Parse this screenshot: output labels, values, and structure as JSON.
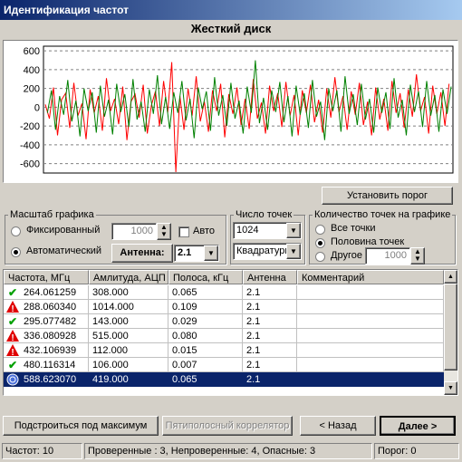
{
  "window": {
    "title": "Идентификация частот"
  },
  "chart_data": {
    "type": "line",
    "title": "Жесткий диск",
    "ylim": [
      -700,
      650
    ],
    "y_ticks": [
      "600",
      "400",
      "200",
      "0",
      "-200",
      "-400",
      "-600"
    ],
    "y_tick_values": [
      600,
      400,
      200,
      0,
      -200,
      -400,
      -600
    ],
    "grid": true,
    "series": [
      {
        "color": "#ff0000",
        "values": [
          30,
          -120,
          210,
          -300,
          80,
          150,
          -220,
          260,
          -90,
          40,
          -340,
          190,
          -60,
          120,
          -250,
          310,
          -40,
          90,
          -180,
          220,
          -350,
          60,
          140,
          -110,
          240,
          -280,
          20,
          170,
          -200,
          280,
          -60,
          480,
          -690,
          120,
          -240,
          200,
          -90,
          330,
          -150,
          60,
          -260,
          180,
          -40,
          250,
          -320,
          140,
          -70,
          210,
          -190,
          90,
          -230,
          300,
          -120,
          50,
          -280,
          230,
          -40,
          150,
          -210,
          270,
          -90,
          130,
          -300,
          180,
          -60,
          240,
          -160,
          80,
          -270,
          200,
          -110,
          320,
          -50,
          120,
          -240,
          170,
          -80,
          260,
          -190,
          60,
          -300,
          210,
          -130,
          90,
          -250,
          280,
          -60,
          150,
          -220,
          190,
          -100,
          350,
          -40,
          110,
          -280,
          230,
          -70,
          160,
          -200,
          250
        ]
      },
      {
        "color": "#008000",
        "values": [
          -60,
          180,
          -240,
          120,
          -80,
          290,
          -150,
          70,
          -310,
          200,
          -40,
          160,
          -270,
          230,
          -100,
          80,
          -290,
          250,
          -50,
          140,
          -210,
          300,
          -130,
          60,
          -260,
          190,
          -70,
          340,
          -180,
          110,
          -230,
          160,
          -60,
          280,
          -140,
          90,
          -330,
          210,
          -20,
          170,
          -250,
          320,
          -90,
          130,
          -200,
          260,
          -120,
          70,
          -280,
          220,
          -60,
          500,
          -170,
          100,
          -240,
          180,
          -50,
          270,
          -160,
          120,
          -310,
          230,
          -80,
          150,
          -220,
          290,
          -100,
          60,
          -350,
          200,
          -40,
          180,
          -260,
          330,
          -70,
          140,
          -190,
          250,
          -130,
          90,
          -270,
          210,
          -60,
          160,
          -230,
          310,
          -110,
          80,
          -300,
          240,
          -50,
          170,
          -210,
          280,
          -90,
          130,
          -260,
          190,
          -70,
          220
        ]
      }
    ]
  },
  "buttons": {
    "threshold": "Установить порог",
    "maximize": "Подстроиться под максимум",
    "correlator": "Пятиполосный коррелятор",
    "back": "< Назад",
    "next": "Далее >"
  },
  "scale_group": {
    "label": "Масштаб графика",
    "fixed_label": "Фиксированный",
    "fixed_value": "1000",
    "auto_check_label": "Авто",
    "automatic_label": "Автоматический",
    "antenna_label": "Антенна:",
    "antenna_value": "2.1"
  },
  "points_group": {
    "label": "Число точек",
    "points_value": "1024",
    "method_value": "Квадратуры"
  },
  "count_group": {
    "label": "Количество точек на графике",
    "all_label": "Все точки",
    "half_label": "Половина точек",
    "other_label": "Другое",
    "other_value": "1000"
  },
  "table": {
    "columns": [
      "Частота, МГц",
      "Амлитуда, АЦП",
      "Полоса, кГц",
      "Антенна",
      "Комментарий"
    ],
    "rows": [
      {
        "status": "check",
        "freq": "264.061259",
        "amp": "308.000",
        "band": "0.065",
        "ant": "2.1",
        "comment": ""
      },
      {
        "status": "warning",
        "freq": "288.060340",
        "amp": "1014.000",
        "band": "0.109",
        "ant": "2.1",
        "comment": ""
      },
      {
        "status": "check",
        "freq": "295.077482",
        "amp": "143.000",
        "band": "0.029",
        "ant": "2.1",
        "comment": ""
      },
      {
        "status": "warning",
        "freq": "336.080928",
        "amp": "515.000",
        "band": "0.080",
        "ant": "2.1",
        "comment": ""
      },
      {
        "status": "warning",
        "freq": "432.106939",
        "amp": "112.000",
        "band": "0.015",
        "ant": "2.1",
        "comment": ""
      },
      {
        "status": "check",
        "freq": "480.116314",
        "amp": "106.000",
        "band": "0.007",
        "ant": "2.1",
        "comment": ""
      },
      {
        "status": "unknown",
        "freq": "588.623070",
        "amp": "419.000",
        "band": "0.065",
        "ant": "2.1",
        "comment": ""
      }
    ]
  },
  "status": {
    "count": "Частот: 10",
    "summary": "Проверенные : 3, Непроверенные: 4, Опасные: 3",
    "threshold": "Порог: 0"
  }
}
